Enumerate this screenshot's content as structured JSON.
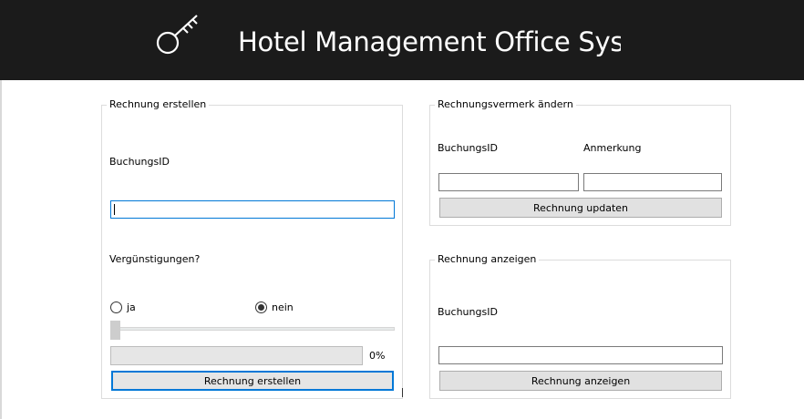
{
  "header": {
    "title": "Hotel Management Office Sys",
    "logo_icon": "key-icon",
    "background": "#1b1b1b"
  },
  "create_invoice": {
    "legend": "Rechnung erstellen",
    "booking_id_label": "BuchungsID",
    "booking_id_value": "",
    "discount_label": "Vergünstigungen?",
    "radio_yes_label": "ja",
    "radio_no_label": "nein",
    "selected_option": "nein",
    "slider_value": 0,
    "progress_fraction": 0,
    "progress_text": "0%",
    "button_label": "Rechnung erstellen"
  },
  "update_note": {
    "legend": "Rechnungsvermerk ändern",
    "booking_id_label": "BuchungsID",
    "booking_id_value": "",
    "note_label": "Anmerkung",
    "note_value": "",
    "button_label": "Rechnung updaten"
  },
  "show_invoice": {
    "legend": "Rechnung anzeigen",
    "booking_id_label": "BuchungsID",
    "booking_id_value": "",
    "button_label": "Rechnung anzeigen"
  },
  "colors": {
    "accent": "#0078d7",
    "button_face": "#e1e1e1",
    "group_border": "#dcdcdc"
  }
}
